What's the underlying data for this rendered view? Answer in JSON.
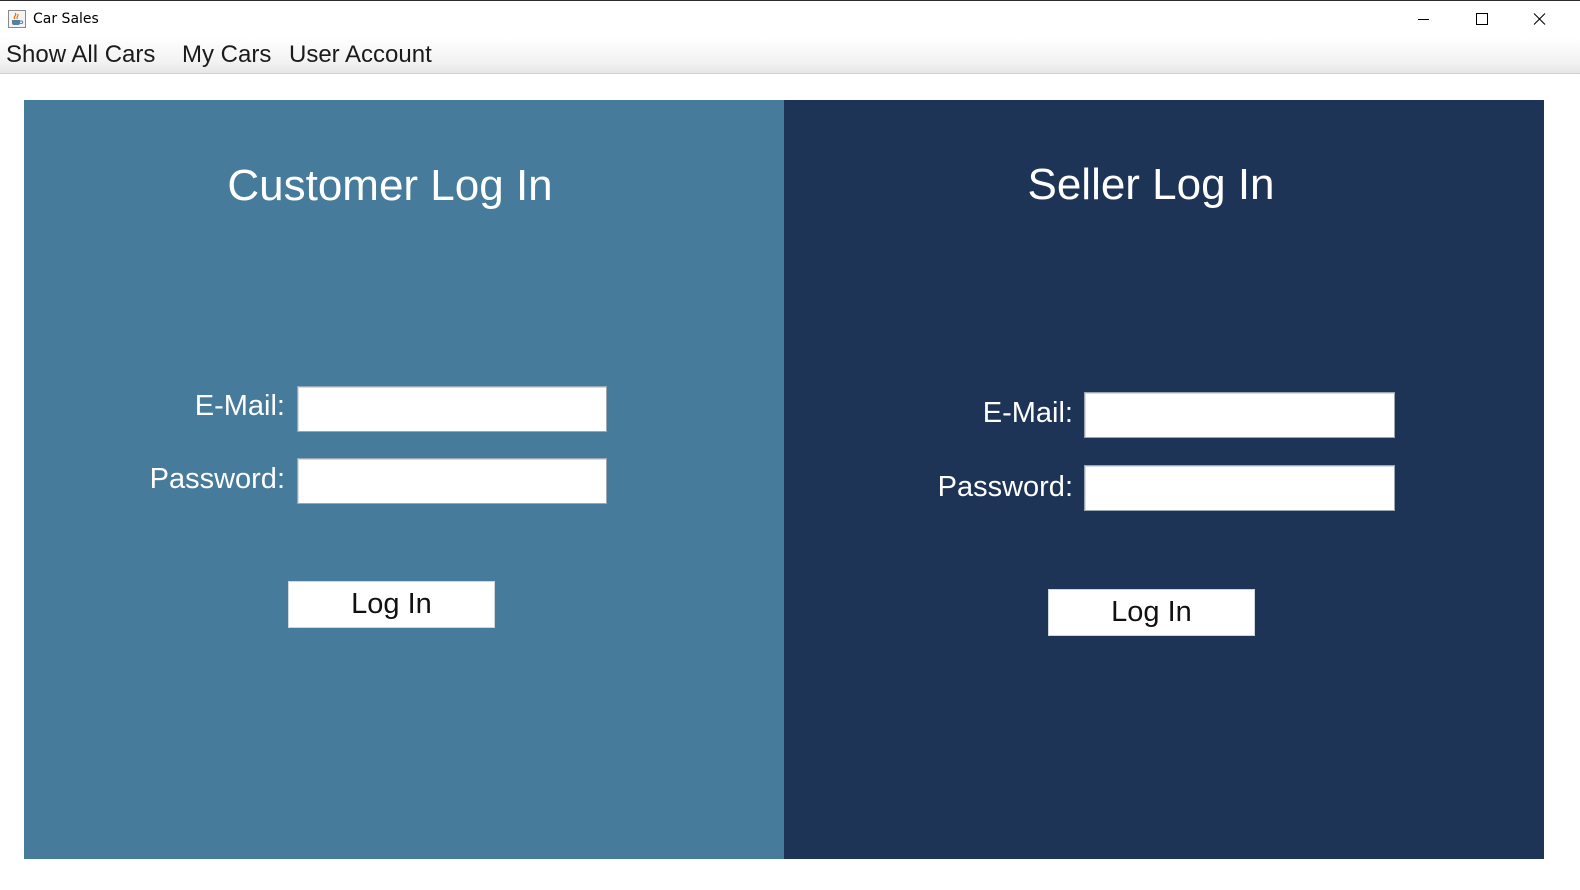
{
  "window": {
    "title": "Car Sales",
    "app_icon": "java-cup-icon",
    "controls": {
      "minimize_icon": "minimize-icon",
      "maximize_icon": "maximize-icon",
      "close_icon": "close-icon"
    }
  },
  "menubar": {
    "items": [
      {
        "label": "Show All Cars"
      },
      {
        "label": "My Cars"
      },
      {
        "label": "User Account"
      }
    ]
  },
  "customer": {
    "title": "Customer Log In",
    "email_label": "E-Mail:",
    "email_value": "",
    "password_label": "Password:",
    "password_value": "",
    "login_label": "Log In",
    "color": "#467b9c"
  },
  "seller": {
    "title": "Seller Log In",
    "email_label": "E-Mail:",
    "email_value": "",
    "password_label": "Password:",
    "password_value": "",
    "login_label": "Log In",
    "color": "#1e3456"
  }
}
